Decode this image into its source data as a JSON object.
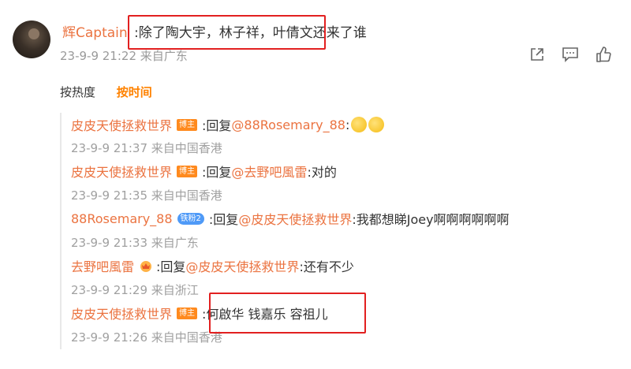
{
  "comment": {
    "username": "辉Captain",
    "text": ":除了陶大宇，林子祥，叶倩文还来了谁",
    "time": "23-9-9 21:22",
    "source": "来自广东",
    "actions": [
      "share-icon",
      "comment-icon",
      "like-icon"
    ]
  },
  "sort_tabs": {
    "hot": "按热度",
    "time": "按时间",
    "active": "time"
  },
  "replies": [
    {
      "user": "皮皮天使拯救世界",
      "badge": "博主",
      "reply_prefix": ":回复",
      "mention": "@88Rosemary_88",
      "text": ":",
      "emojis": 2,
      "time": "23-9-9 21:37",
      "source": "来自中国香港"
    },
    {
      "user": "皮皮天使拯救世界",
      "badge": "博主",
      "reply_prefix": ":回复",
      "mention": "@去野吧風雷",
      "text": ":对的",
      "time": "23-9-9 21:35",
      "source": "来自中国香港"
    },
    {
      "user": "88Rosemary_88",
      "badge": "铁粉2",
      "reply_prefix": ":回复",
      "mention": "@皮皮天使拯救世界",
      "text": ":我都想睇Joey啊啊啊啊啊啊",
      "time": "23-9-9 21:33",
      "source": "来自广东"
    },
    {
      "user": "去野吧風雷",
      "badge": "",
      "reply_prefix": ":回复",
      "mention": "@皮皮天使拯救世界",
      "text": ":还有不少",
      "time": "23-9-9 21:29",
      "source": "来自浙江"
    },
    {
      "user": "皮皮天使拯救世界",
      "badge": "博主",
      "reply_prefix": "",
      "mention": "",
      "text": ":何啟华 钱嘉乐 容祖儿",
      "time": "23-9-9 21:26",
      "source": "来自中国香港"
    }
  ],
  "colors": {
    "username": "#eb7340",
    "active_tab": "#ff8200",
    "timestamp": "#a0a0a0",
    "highlight_box": "#e22020",
    "badge_bz": "#ff8a1e",
    "badge_fan": "#4f9af7"
  }
}
